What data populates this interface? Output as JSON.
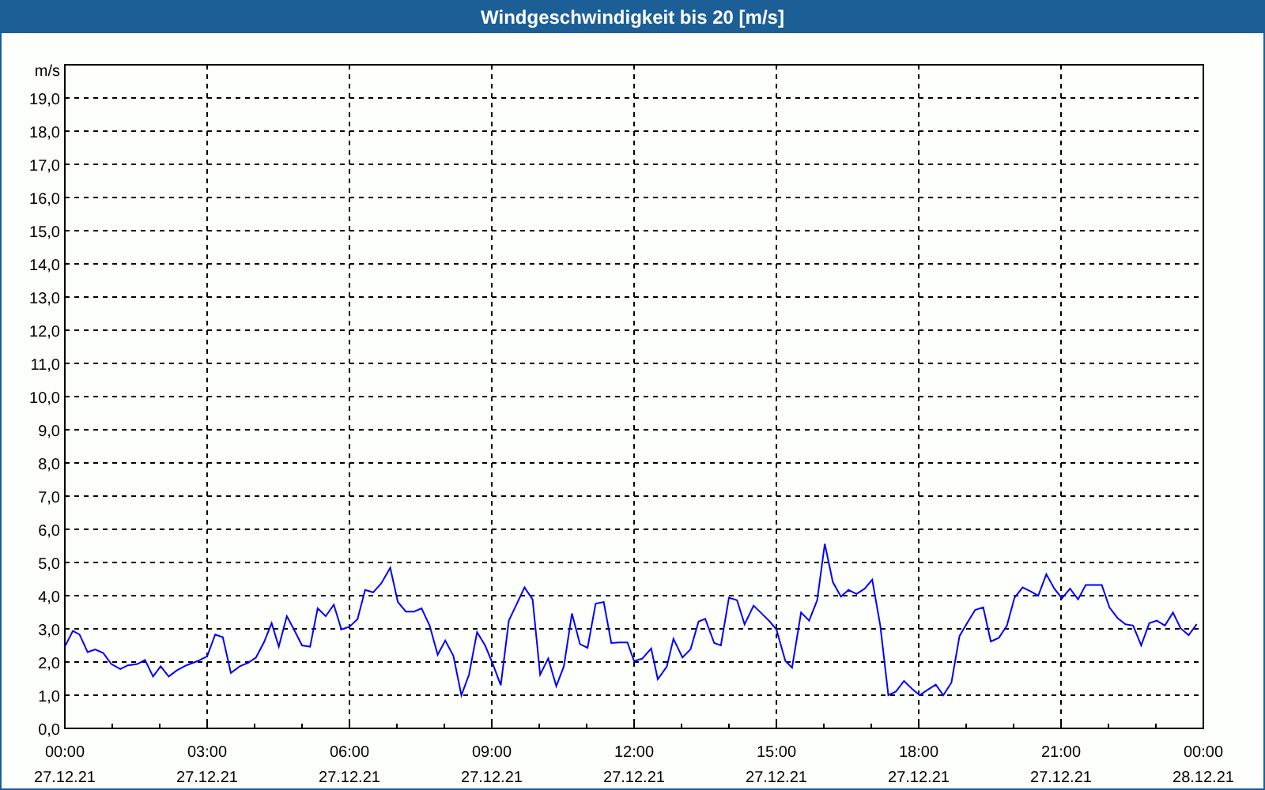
{
  "window": {
    "title": "Windgeschwindigkeit bis 20 [m/s]"
  },
  "chart": {
    "date_labels": [
      "27.12.21",
      "27.12.21",
      "27.12.21",
      "27.12.21",
      "27.12.21",
      "27.12.21",
      "27.12.21",
      "27.12.21",
      "28.12.21"
    ],
    "chart_data": {
      "type": "line",
      "grid": true,
      "ylabel": "m/s",
      "xlim": [
        0,
        24
      ],
      "ylim": [
        0,
        20
      ],
      "xticks": [
        {
          "value": 0,
          "label": "00:00"
        },
        {
          "value": 3,
          "label": "03:00"
        },
        {
          "value": 6,
          "label": "06:00"
        },
        {
          "value": 9,
          "label": "09:00"
        },
        {
          "value": 12,
          "label": "12:00"
        },
        {
          "value": 15,
          "label": "15:00"
        },
        {
          "value": 18,
          "label": "18:00"
        },
        {
          "value": 21,
          "label": "21:00"
        },
        {
          "value": 24,
          "label": "00:00"
        }
      ],
      "yticks": [
        {
          "value": 0,
          "label": "0,0"
        },
        {
          "value": 1,
          "label": "1,0"
        },
        {
          "value": 2,
          "label": "2,0"
        },
        {
          "value": 3,
          "label": "3,0"
        },
        {
          "value": 4,
          "label": "4,0"
        },
        {
          "value": 5,
          "label": "5,0"
        },
        {
          "value": 6,
          "label": "6,0"
        },
        {
          "value": 7,
          "label": "7,0"
        },
        {
          "value": 8,
          "label": "8,0"
        },
        {
          "value": 9,
          "label": "9,0"
        },
        {
          "value": 10,
          "label": "10,0"
        },
        {
          "value": 11,
          "label": "11,0"
        },
        {
          "value": 12,
          "label": "12,0"
        },
        {
          "value": 13,
          "label": "13,0"
        },
        {
          "value": 14,
          "label": "14,0"
        },
        {
          "value": 15,
          "label": "15,0"
        },
        {
          "value": 16,
          "label": "16,0"
        },
        {
          "value": 17,
          "label": "17,0"
        },
        {
          "value": 18,
          "label": "18,0"
        },
        {
          "value": 19,
          "label": "19,0"
        }
      ],
      "x": [
        0,
        0.17,
        0.31,
        0.48,
        0.64,
        0.81,
        0.98,
        1.17,
        1.33,
        1.53,
        1.69,
        1.86,
        2.02,
        2.19,
        2.36,
        2.56,
        2.8,
        3,
        3.17,
        3.33,
        3.5,
        3.69,
        3.87,
        4.03,
        4.2,
        4.36,
        4.51,
        4.68,
        4.83,
        5,
        5.17,
        5.33,
        5.5,
        5.67,
        5.83,
        6,
        6.17,
        6.33,
        6.5,
        6.67,
        6.86,
        7.02,
        7.19,
        7.36,
        7.52,
        7.69,
        7.86,
        8.02,
        8.19,
        8.36,
        8.52,
        8.69,
        8.86,
        9.02,
        9.19,
        9.36,
        9.52,
        9.69,
        9.86,
        10.02,
        10.19,
        10.36,
        10.52,
        10.69,
        10.86,
        11.02,
        11.19,
        11.36,
        11.52,
        11.69,
        11.86,
        12,
        12.17,
        12.36,
        12.5,
        12.69,
        12.83,
        13.02,
        13.19,
        13.36,
        13.5,
        13.69,
        13.83,
        14,
        14.17,
        14.33,
        14.52,
        14.69,
        14.86,
        15,
        15.19,
        15.33,
        15.52,
        15.69,
        15.86,
        16.02,
        16.19,
        16.36,
        16.52,
        16.69,
        16.86,
        17.02,
        17.19,
        17.36,
        17.52,
        17.69,
        17.86,
        18.02,
        18.19,
        18.36,
        18.52,
        18.69,
        18.86,
        19.02,
        19.19,
        19.36,
        19.52,
        19.69,
        19.86,
        20.02,
        20.19,
        20.36,
        20.52,
        20.69,
        20.86,
        21.02,
        21.19,
        21.36,
        21.52,
        21.69,
        21.86,
        22.02,
        22.19,
        22.36,
        22.52,
        22.69,
        22.86,
        23.02,
        23.19,
        23.36,
        23.52,
        23.69,
        23.86
      ],
      "series": [
        {
          "color": "#0000ff",
          "values": [
            2.46,
            2.94,
            2.83,
            2.3,
            2.38,
            2.27,
            1.94,
            1.79,
            1.9,
            1.94,
            2.06,
            1.56,
            1.87,
            1.56,
            1.75,
            1.9,
            2.03,
            2.17,
            2.83,
            2.75,
            1.67,
            1.87,
            1.98,
            2.14,
            2.6,
            3.17,
            2.46,
            3.38,
            2.98,
            2.5,
            2.46,
            3.62,
            3.38,
            3.73,
            2.98,
            3.06,
            3.29,
            4.17,
            4.1,
            4.37,
            4.84,
            3.81,
            3.52,
            3.52,
            3.62,
            3.1,
            2.22,
            2.65,
            2.19,
            1.0,
            1.62,
            2.9,
            2.5,
            1.95,
            1.3,
            3.25,
            3.73,
            4.25,
            3.89,
            1.62,
            2.11,
            1.27,
            1.87,
            3.46,
            2.54,
            2.43,
            3.76,
            3.81,
            2.57,
            2.59,
            2.59,
            2.03,
            2.1,
            2.41,
            1.48,
            1.86,
            2.7,
            2.14,
            2.38,
            3.22,
            3.3,
            2.57,
            2.5,
            3.94,
            3.86,
            3.14,
            3.7,
            3.46,
            3.22,
            2.98,
            2.03,
            1.83,
            3.49,
            3.25,
            3.86,
            5.56,
            4.41,
            3.97,
            4.17,
            4.05,
            4.21,
            4.48,
            3.1,
            1.0,
            1.11,
            1.43,
            1.19,
            1.0,
            1.16,
            1.32,
            1.0,
            1.38,
            2.78,
            3.17,
            3.57,
            3.65,
            2.62,
            2.73,
            3.1,
            3.94,
            4.25,
            4.13,
            4.0,
            4.65,
            4.21,
            3.92,
            4.21,
            3.89,
            4.32,
            4.32,
            4.32,
            3.65,
            3.33,
            3.14,
            3.1,
            2.5,
            3.17,
            3.25,
            3.1,
            3.49,
            3.02,
            2.81,
            3.14
          ]
        }
      ]
    }
  }
}
